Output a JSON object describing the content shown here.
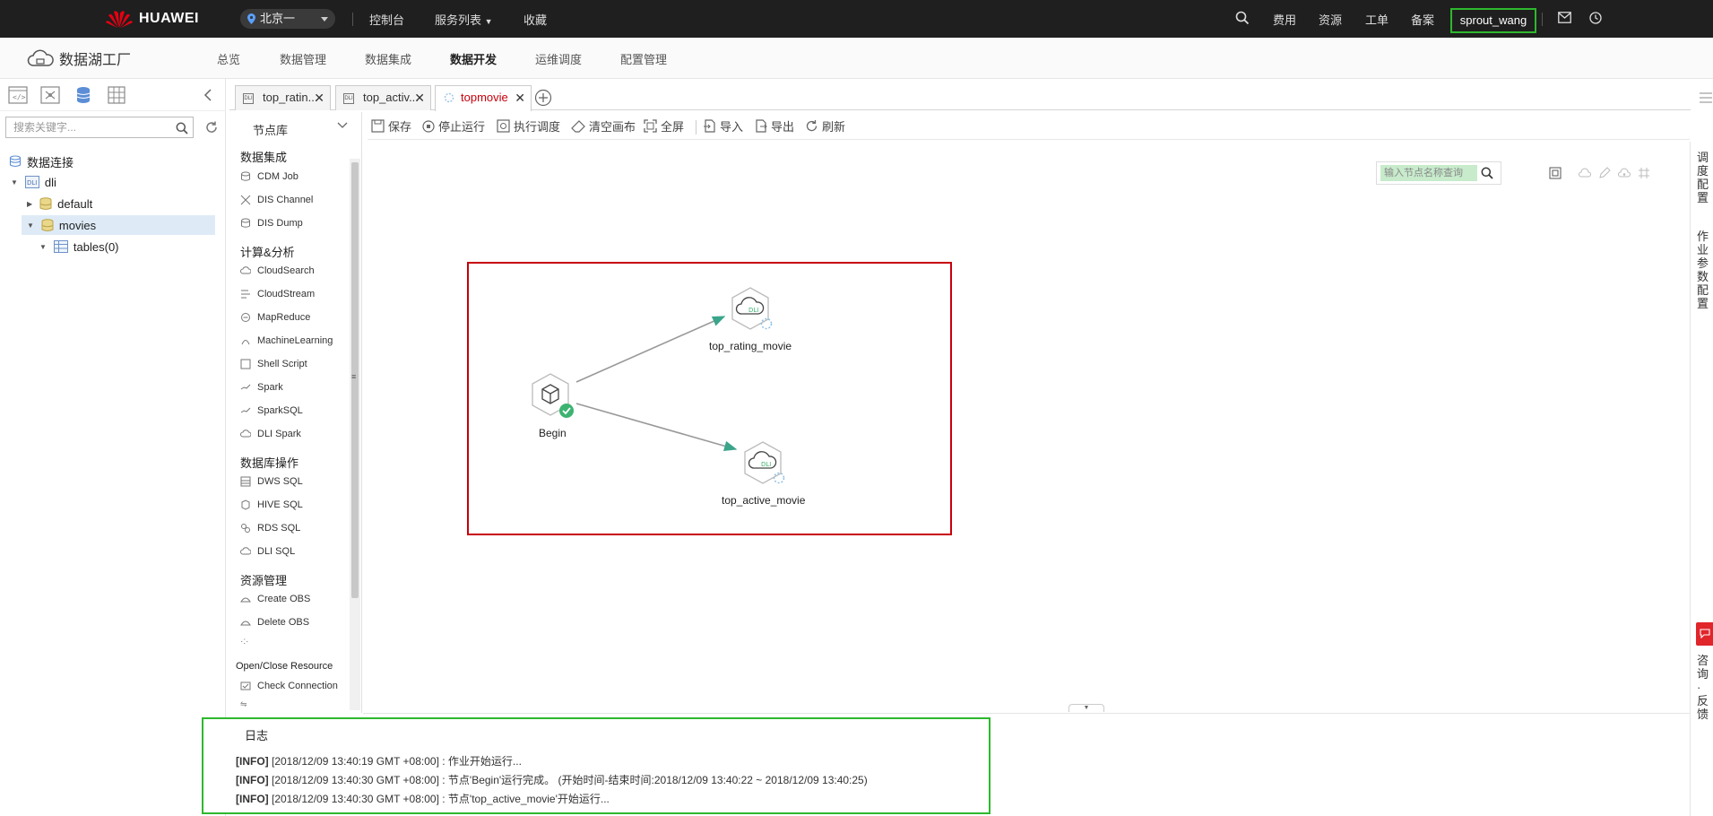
{
  "topbar": {
    "brand": "HUAWEI",
    "region": "北京一",
    "nav": [
      "控制台",
      "服务列表",
      "收藏"
    ],
    "right_links": [
      "费用",
      "资源",
      "工单",
      "备案"
    ],
    "user": "sprout_wang"
  },
  "header": {
    "product": "数据湖工厂",
    "menu": [
      "总览",
      "数据管理",
      "数据集成",
      "数据开发",
      "运维调度",
      "配置管理"
    ],
    "active": "数据开发"
  },
  "tree": {
    "search_placeholder": "搜索关键字...",
    "root": "数据连接",
    "connection": "dli",
    "databases": [
      "default",
      "movies"
    ],
    "selected_db": "movies",
    "child": "tables(0)"
  },
  "tabs": [
    {
      "label": "top_ratin..."
    },
    {
      "label": "top_activ..."
    },
    {
      "label": "topmovie"
    }
  ],
  "node_library": {
    "header": "节点库",
    "categories": [
      {
        "label": "数据集成",
        "items": [
          "CDM Job",
          "DIS Channel",
          "DIS Dump"
        ]
      },
      {
        "label": "计算&分析",
        "items": [
          "CloudSearch",
          "CloudStream",
          "MapReduce",
          "MachineLearning",
          "Shell Script",
          "Spark",
          "SparkSQL",
          "DLI Spark"
        ]
      },
      {
        "label": "数据库操作",
        "items": [
          "DWS SQL",
          "HIVE SQL",
          "RDS SQL",
          "DLI SQL"
        ]
      },
      {
        "label": "资源管理",
        "items": [
          "Create OBS",
          "Delete OBS"
        ]
      },
      {
        "label": "Open/Close Resource",
        "items": [
          "Check Connection"
        ]
      }
    ]
  },
  "toolbar": {
    "buttons": [
      "保存",
      "停止运行",
      "执行调度",
      "清空画布",
      "全屏",
      "导入",
      "导出",
      "刷新"
    ]
  },
  "canvas": {
    "search_placeholder": "输入节点名称查询",
    "nodes": [
      {
        "name": "Begin",
        "status": "success"
      },
      {
        "name": "top_rating_movie",
        "status": "running"
      },
      {
        "name": "top_active_movie",
        "status": "running"
      }
    ]
  },
  "right_rail": [
    "调度配置",
    "作业参数配置",
    "咨询·反馈"
  ],
  "log": {
    "title": "日志",
    "lines": [
      {
        "level": "[INFO]",
        "text": " [2018/12/09 13:40:19 GMT +08:00] : 作业开始运行..."
      },
      {
        "level": "[INFO]",
        "text": " [2018/12/09 13:40:30 GMT +08:00] : 节点'Begin'运行完成。 (开始时间-结束时间:2018/12/09 13:40:22 ~ 2018/12/09 13:40:25)"
      },
      {
        "level": "[INFO]",
        "text": " [2018/12/09 13:40:30 GMT +08:00] : 节点'top_active_movie'开始运行..."
      }
    ]
  },
  "colors": {
    "accent_red": "#c7000b",
    "success_green": "#3cb371",
    "highlight_green": "#2eb82e"
  }
}
